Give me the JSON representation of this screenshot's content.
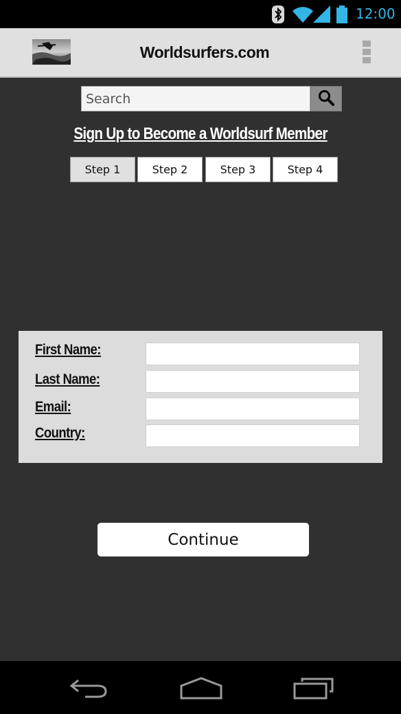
{
  "status_bar": {
    "time": "12:00",
    "icons": [
      "bluetooth-icon",
      "wifi-icon",
      "signal-icon",
      "battery-icon"
    ],
    "accent_color": "#33b5e5"
  },
  "app_bar": {
    "title": "Worldsurfers.com",
    "logo": "surfer-photo-logo",
    "menu_icon": "overflow-menu-icon"
  },
  "search": {
    "placeholder": "Search",
    "button_icon": "search-icon"
  },
  "signup": {
    "heading": "Sign Up to Become a Worldsurf Member",
    "steps": [
      {
        "label": "Step 1",
        "active": true
      },
      {
        "label": "Step 2",
        "active": false
      },
      {
        "label": "Step 3",
        "active": false
      },
      {
        "label": "Step 4",
        "active": false
      }
    ]
  },
  "form": {
    "fields": [
      {
        "label": "First Name:",
        "value": ""
      },
      {
        "label": "Last Name:",
        "value": ""
      },
      {
        "label": "Email:",
        "value": ""
      },
      {
        "label": "Country:",
        "value": ""
      }
    ],
    "continue_label": "Continue"
  },
  "nav_bar": {
    "buttons": [
      "back-icon",
      "home-icon",
      "recent-apps-icon"
    ]
  },
  "colors": {
    "background": "#303030",
    "panel": "#dcdcdc",
    "app_bar": "#e0e0e0"
  }
}
